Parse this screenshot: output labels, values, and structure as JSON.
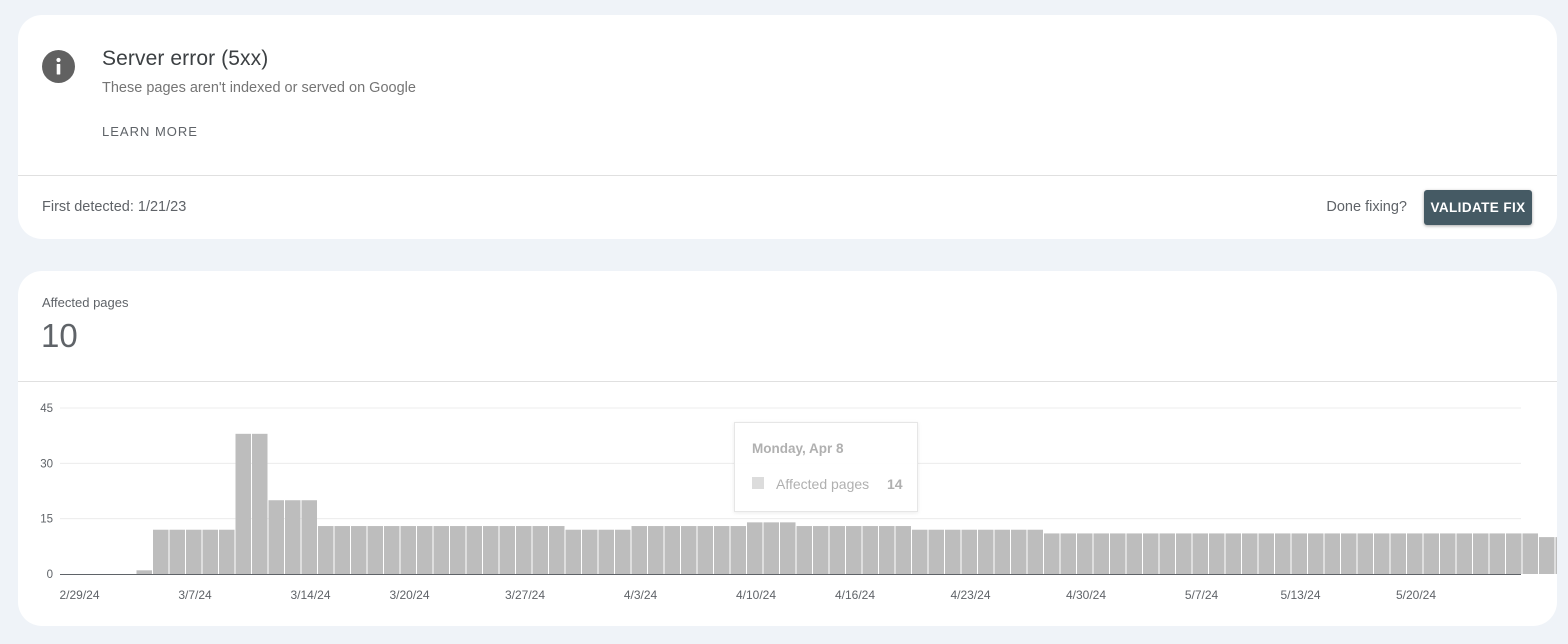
{
  "issue": {
    "title": "Server error (5xx)",
    "subtitle": "These pages aren't indexed or served on Google",
    "learn_more": "LEARN MORE",
    "first_detected": "First detected: 1/21/23",
    "done_fixing": "Done fixing?",
    "validate_fix": "VALIDATE FIX",
    "icon": "info-icon"
  },
  "metric": {
    "label": "Affected pages",
    "value": "10"
  },
  "tooltip": {
    "date": "Monday, Apr 8",
    "label": "Affected pages",
    "value": "14"
  },
  "colors": {
    "bar": "#bdbdbd",
    "button": "#455a64",
    "page_bg": "#eff3f8"
  },
  "chart_data": {
    "type": "bar",
    "title": "",
    "xlabel": "",
    "ylabel": "",
    "ylim": [
      0,
      45
    ],
    "y_ticks": [
      0,
      15,
      30,
      45
    ],
    "grid": true,
    "x_tick_labels": [
      "2/29/24",
      "3/7/24",
      "3/14/24",
      "3/20/24",
      "3/27/24",
      "4/3/24",
      "4/10/24",
      "4/16/24",
      "4/23/24",
      "4/30/24",
      "5/7/24",
      "5/13/24",
      "5/20/24"
    ],
    "x_tick_indices": [
      0,
      7,
      14,
      20,
      27,
      34,
      41,
      47,
      54,
      61,
      68,
      74,
      81
    ],
    "series": [
      {
        "values": [
          0,
          0,
          1,
          12,
          12,
          12,
          12,
          12,
          38,
          38,
          20,
          20,
          20,
          13,
          13,
          13,
          13,
          13,
          13,
          13,
          13,
          13,
          13,
          13,
          13,
          13,
          13,
          13,
          12,
          12,
          12,
          12,
          13,
          13,
          13,
          13,
          13,
          13,
          13,
          14,
          14,
          14,
          13,
          13,
          13,
          13,
          13,
          13,
          13,
          12,
          12,
          12,
          12,
          12,
          12,
          12,
          12,
          11,
          11,
          11,
          11,
          11,
          11,
          11,
          11,
          11,
          11,
          11,
          11,
          11,
          11,
          11,
          11,
          11,
          11,
          11,
          11,
          11,
          11,
          11,
          11,
          11,
          11,
          11,
          11,
          11,
          11,
          10,
          10,
          10,
          10
        ]
      }
    ]
  }
}
